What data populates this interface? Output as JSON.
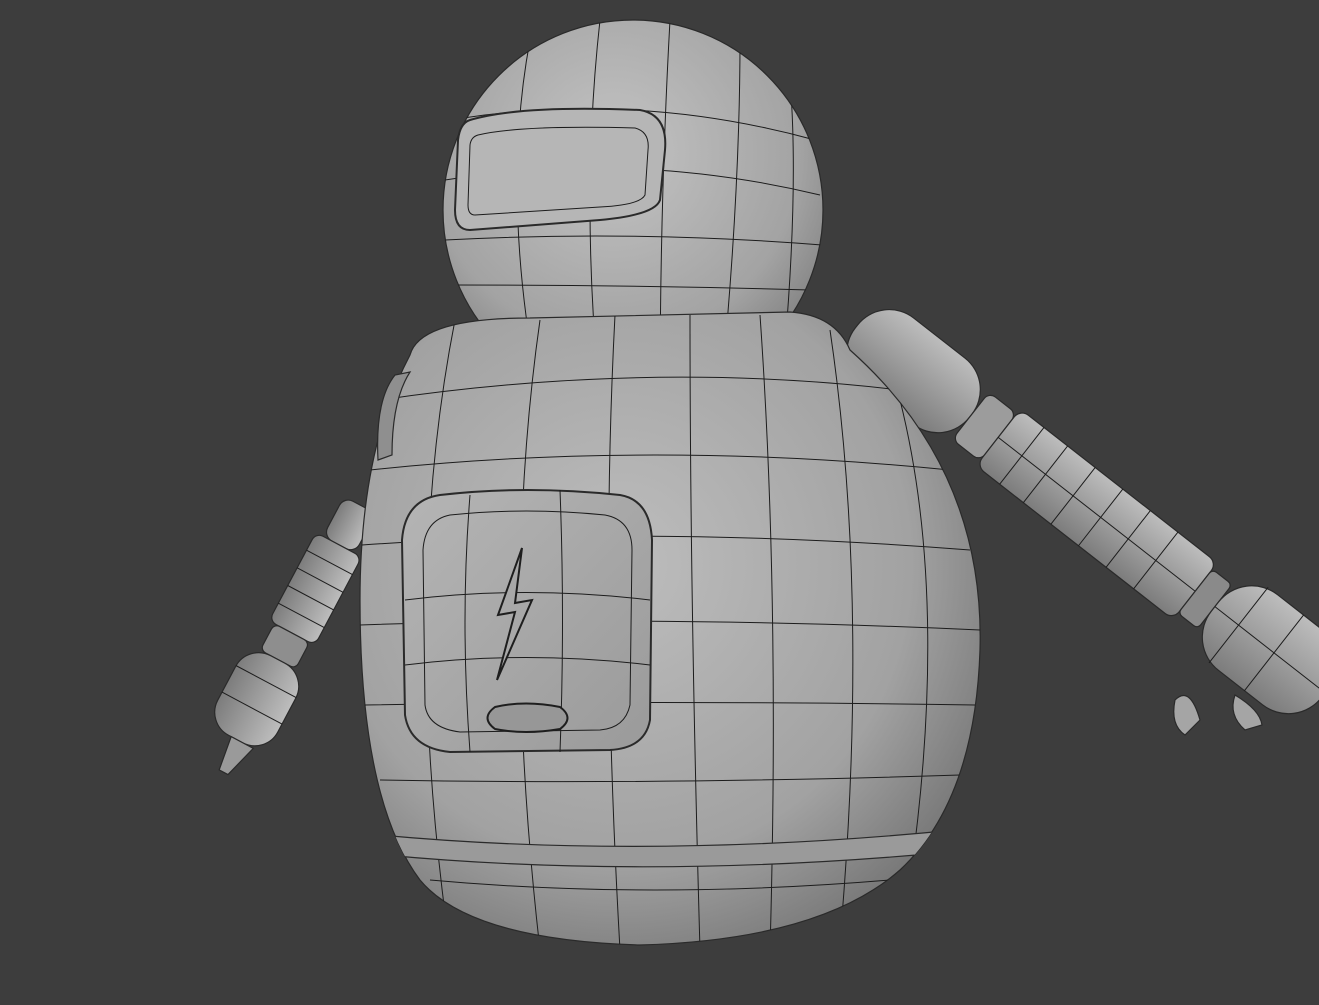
{
  "scene": {
    "background_color": "#3d3d3d",
    "mesh_color": "#a9a9a9",
    "mesh_shadow_color": "#6e6e6e",
    "wire_color": "#1c1c1c"
  }
}
